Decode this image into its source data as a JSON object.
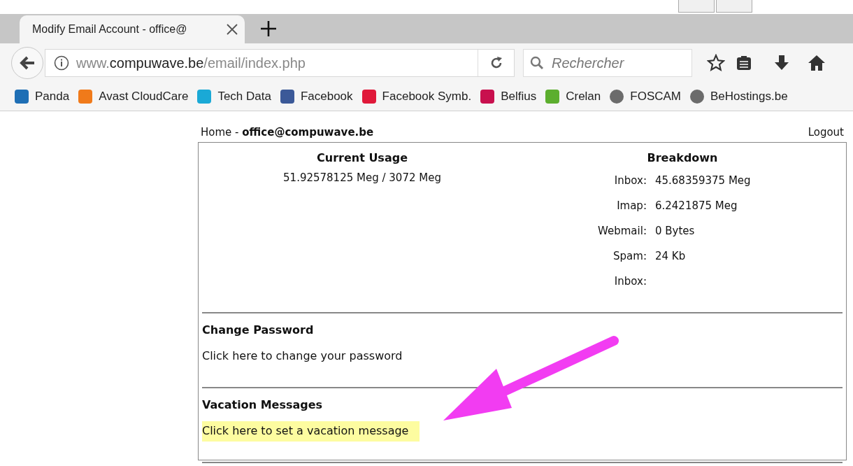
{
  "tab": {
    "title": "Modify Email Account - office@",
    "selected": true
  },
  "address": {
    "prefix": "www.",
    "domain": "compuwave.be",
    "path": "/email/index.php"
  },
  "search": {
    "placeholder": "Rechercher"
  },
  "bookmarks": [
    {
      "label": "Panda",
      "color": "#1f6fb5"
    },
    {
      "label": "Avast CloudCare",
      "color": "#f07a1a"
    },
    {
      "label": "Tech Data",
      "color": "#1aa9d6"
    },
    {
      "label": "Facebook",
      "color": "#3b5998"
    },
    {
      "label": "Facebook Symb.",
      "color": "#e0193a"
    },
    {
      "label": "Belfius",
      "color": "#c8104e"
    },
    {
      "label": "Crelan",
      "color": "#5cae2e"
    },
    {
      "label": "FOSCAM",
      "color": "#6b6b6b"
    },
    {
      "label": "BeHostings.be",
      "color": "#6b6b6b"
    }
  ],
  "header": {
    "home": "Home",
    "separator": "-",
    "account": "office@compuwave.be",
    "logout": "Logout"
  },
  "usage": {
    "title": "Current Usage",
    "value": "51.92578125 Meg / 3072 Meg"
  },
  "breakdown": {
    "title": "Breakdown",
    "rows": [
      {
        "label": "Inbox:",
        "value": "45.68359375 Meg"
      },
      {
        "label": "Imap:",
        "value": "6.2421875 Meg"
      },
      {
        "label": "Webmail:",
        "value": "0 Bytes"
      },
      {
        "label": "Spam:",
        "value": "24 Kb"
      },
      {
        "label": "Inbox:",
        "value": ""
      }
    ]
  },
  "sections": [
    {
      "title": "Change Password",
      "link": "Click here to change your password",
      "highlighted": false
    },
    {
      "title": "Vacation Messages",
      "link": "Click here to set a vacation message",
      "highlighted": true
    }
  ]
}
